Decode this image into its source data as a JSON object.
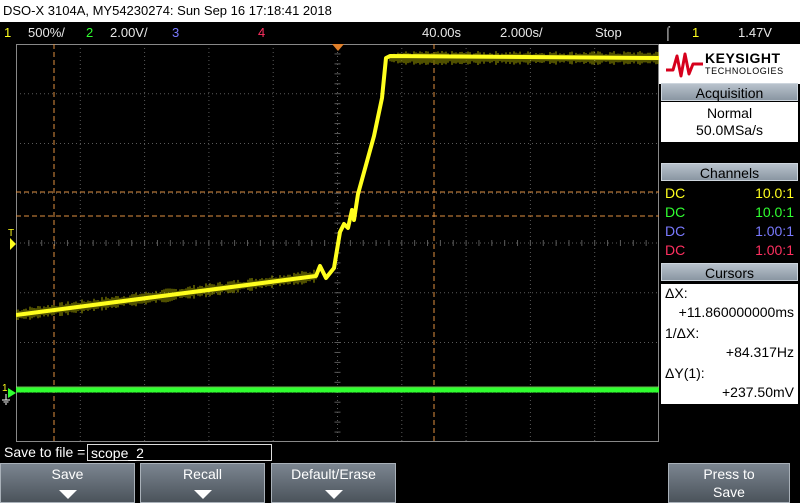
{
  "window_title": "DSO-X 3104A, MY54230274: Sun Sep 16 17:18:41 2018",
  "status": {
    "ch1_num": "1",
    "ch1_scale": "500%/",
    "ch2_num": "2",
    "ch2_scale": "2.00V/",
    "ch3_num": "3",
    "ch4_num": "4",
    "delay": "40.00s",
    "timebase": "2.000s/",
    "run_state": "Stop",
    "trigger_source": "1",
    "trigger_level": "1.47V"
  },
  "logo": {
    "name": "KEYSIGHT",
    "sub": "TECHNOLOGIES"
  },
  "acquisition": {
    "heading": "Acquisition",
    "mode": "Normal",
    "rate": "50.0MSa/s"
  },
  "channels": {
    "heading": "Channels",
    "rows": [
      {
        "coupling": "DC",
        "probe": "10.0:1",
        "color": "#ffff1e"
      },
      {
        "coupling": "DC",
        "probe": "10.0:1",
        "color": "#30ff30"
      },
      {
        "coupling": "DC",
        "probe": "1.00:1",
        "color": "#7a7aff"
      },
      {
        "coupling": "DC",
        "probe": "1.00:1",
        "color": "#ff3060"
      }
    ]
  },
  "cursors": {
    "heading": "Cursors",
    "dx_label": "ΔX:",
    "dx_value": "+11.860000000ms",
    "inv_label": "1/ΔX:",
    "inv_value": "+84.317Hz",
    "dy_label": "ΔY(1):",
    "dy_value": "+237.50mV"
  },
  "save": {
    "label": "Save to file =",
    "filename": "scope_2"
  },
  "softkeys": [
    {
      "label": "Save"
    },
    {
      "label": "Recall"
    },
    {
      "label": "Default/Erase"
    },
    {
      "label": "Press to",
      "label2": "Save"
    }
  ],
  "markers": {
    "trigger_label": "T",
    "ground_label": "1"
  },
  "colors": {
    "ch1": "#ffff1e",
    "ch2": "#30ff30",
    "grid": "#5a5a5a",
    "cursor": "#e09040",
    "panel_head": "#9aa6b2"
  }
}
